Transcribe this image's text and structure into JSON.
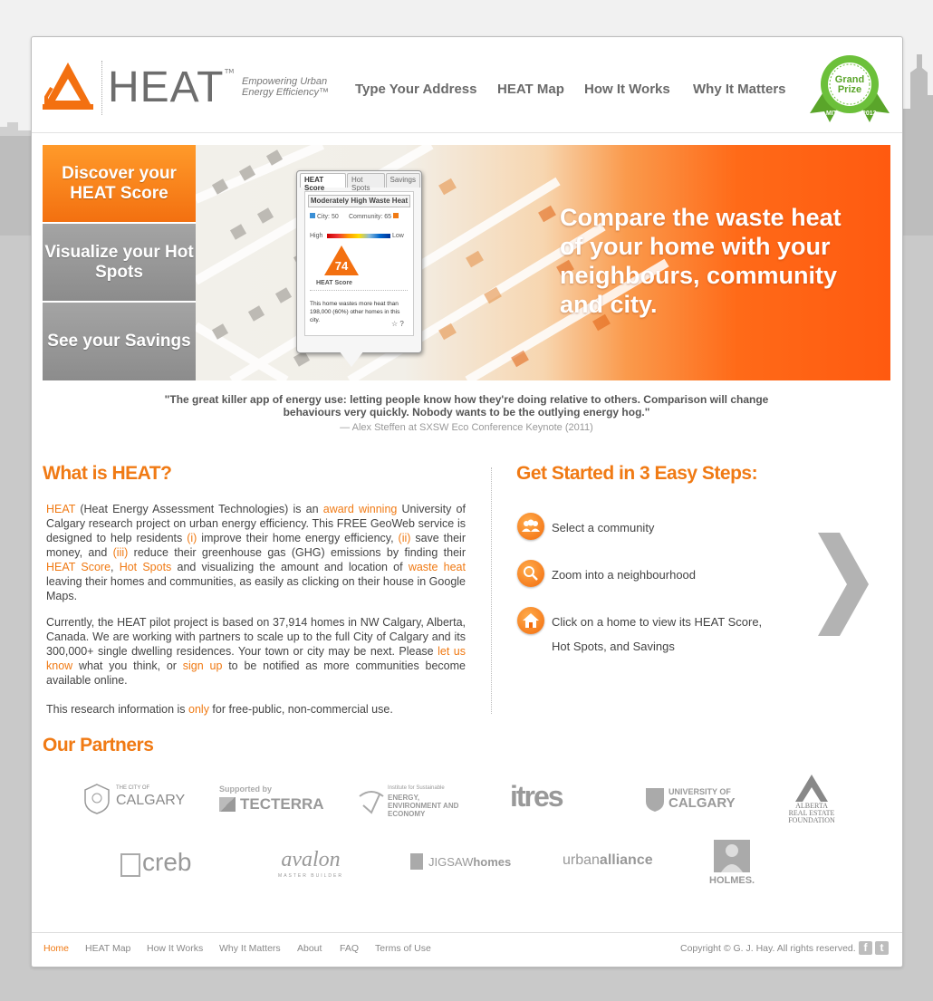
{
  "colors": {
    "accent": "#f07a14",
    "hero_orange": "#ff6a18",
    "tab_inactive": "#999999",
    "page_bg": "#c9c9c9"
  },
  "header": {
    "logo_text": "HEAT",
    "logo_tm": "TM",
    "tagline": "Empowering Urban Energy Efficiency™",
    "nav": [
      "Type Your Address",
      "HEAT Map",
      "How It Works",
      "Why It Matters"
    ],
    "award": {
      "line1": "Grand",
      "line2": "Prize",
      "left": "MIT",
      "right": "2013"
    }
  },
  "banner": {
    "tabs": [
      "Discover your HEAT Score",
      "Visualize your Hot Spots",
      "See your Savings"
    ],
    "hero": "Compare the waste heat of your home with your neighbours, community and city.",
    "popup": {
      "tabs": [
        "HEAT Score",
        "Hot Spots",
        "Savings"
      ],
      "title": "Moderately High Waste Heat",
      "city": "City: 50",
      "community": "Community: 65",
      "high": "High",
      "low": "Low",
      "score": "74",
      "score_label": "HEAT Score",
      "description": "This home wastes more heat than 198,000 (60%) other homes in this city.",
      "icons": "☆ ?"
    }
  },
  "quote": {
    "text": "\"The great killer app of energy use: letting people know how they're doing relative to others. Comparison will change behaviours very quickly. Nobody wants to be the outlying energy hog.\"",
    "attribution": "— Alex Steffen at SXSW Eco Conference Keynote (2011)"
  },
  "what_is": {
    "title": "What is HEAT?",
    "p1": {
      "s1": "HEAT",
      "s2": " (Heat Energy Assessment Technologies) is an ",
      "s3": "award winning",
      "s4": " University of Calgary research project on urban energy efficiency. This FREE GeoWeb service is designed to help residents ",
      "s5": "(i)",
      "s6": " improve their home energy efficiency, ",
      "s7": "(ii)",
      "s8": " save their money, and ",
      "s9": "(iii)",
      "s10": " reduce their greenhouse gas (GHG) emissions by finding their ",
      "s11": "HEAT Score",
      "s12": ", ",
      "s13": "Hot Spots",
      "s14": " and visualizing the amount and location of ",
      "s15": "waste heat",
      "s16": " leaving their homes and communities, as easily as clicking on their house in Google Maps."
    },
    "p2": {
      "s1": "Currently, the HEAT pilot project is based on 37,914 homes in NW Calgary, Alberta, Canada. We are working with partners to scale up to the full City of Calgary and its 300,000+ single dwelling residences. Your town or city may be next. Please ",
      "s2": "let us know",
      "s3": " what you think, or ",
      "s4": "sign up",
      "s5": " to be notified as more communities become available online."
    },
    "p3": {
      "s1": "This research information is ",
      "s2": "only",
      "s3": " for free-public, non-commercial use."
    }
  },
  "get_started": {
    "title": "Get Started in 3 Easy Steps:",
    "steps": [
      {
        "icon": "community-icon",
        "label": "Select a community"
      },
      {
        "icon": "magnifier-icon",
        "label": "Zoom into a neighbourhood"
      },
      {
        "icon": "home-icon",
        "label": "Click on a home to view its HEAT Score, Hot Spots, and Savings"
      }
    ]
  },
  "partners": {
    "title": "Our Partners",
    "logos": {
      "calgary": {
        "small": "THE CITY OF",
        "name": "CALGARY"
      },
      "tecterra": {
        "small": "Supported by",
        "name": "TECTERRA"
      },
      "iseee": {
        "small": "Institute for Sustainable",
        "name": "ENERGY, ENVIRONMENT AND ECONOMY"
      },
      "itres": {
        "name": "itres"
      },
      "ucalgary": {
        "small": "UNIVERSITY OF",
        "name": "CALGARY"
      },
      "arefa": {
        "line1": "ALBERTA",
        "line2": "REAL ESTATE",
        "line3": "FOUNDATION"
      },
      "creb": {
        "name": "creb"
      },
      "avalon": {
        "name": "avalon",
        "small": "MASTER BUILDER"
      },
      "jigsaw": {
        "name1": "JIGSAW",
        "name2": "homes"
      },
      "urban": {
        "name1": "urban",
        "name2": "alliance"
      },
      "holmes": {
        "name": "HOLMES."
      }
    }
  },
  "footer": {
    "links": [
      "Home",
      "HEAT Map",
      "How It Works",
      "Why It Matters",
      "About",
      "FAQ",
      "Terms of Use"
    ],
    "copyright": "Copyright © G. J. Hay. All rights reserved.",
    "facebook": "f",
    "twitter": "t"
  }
}
